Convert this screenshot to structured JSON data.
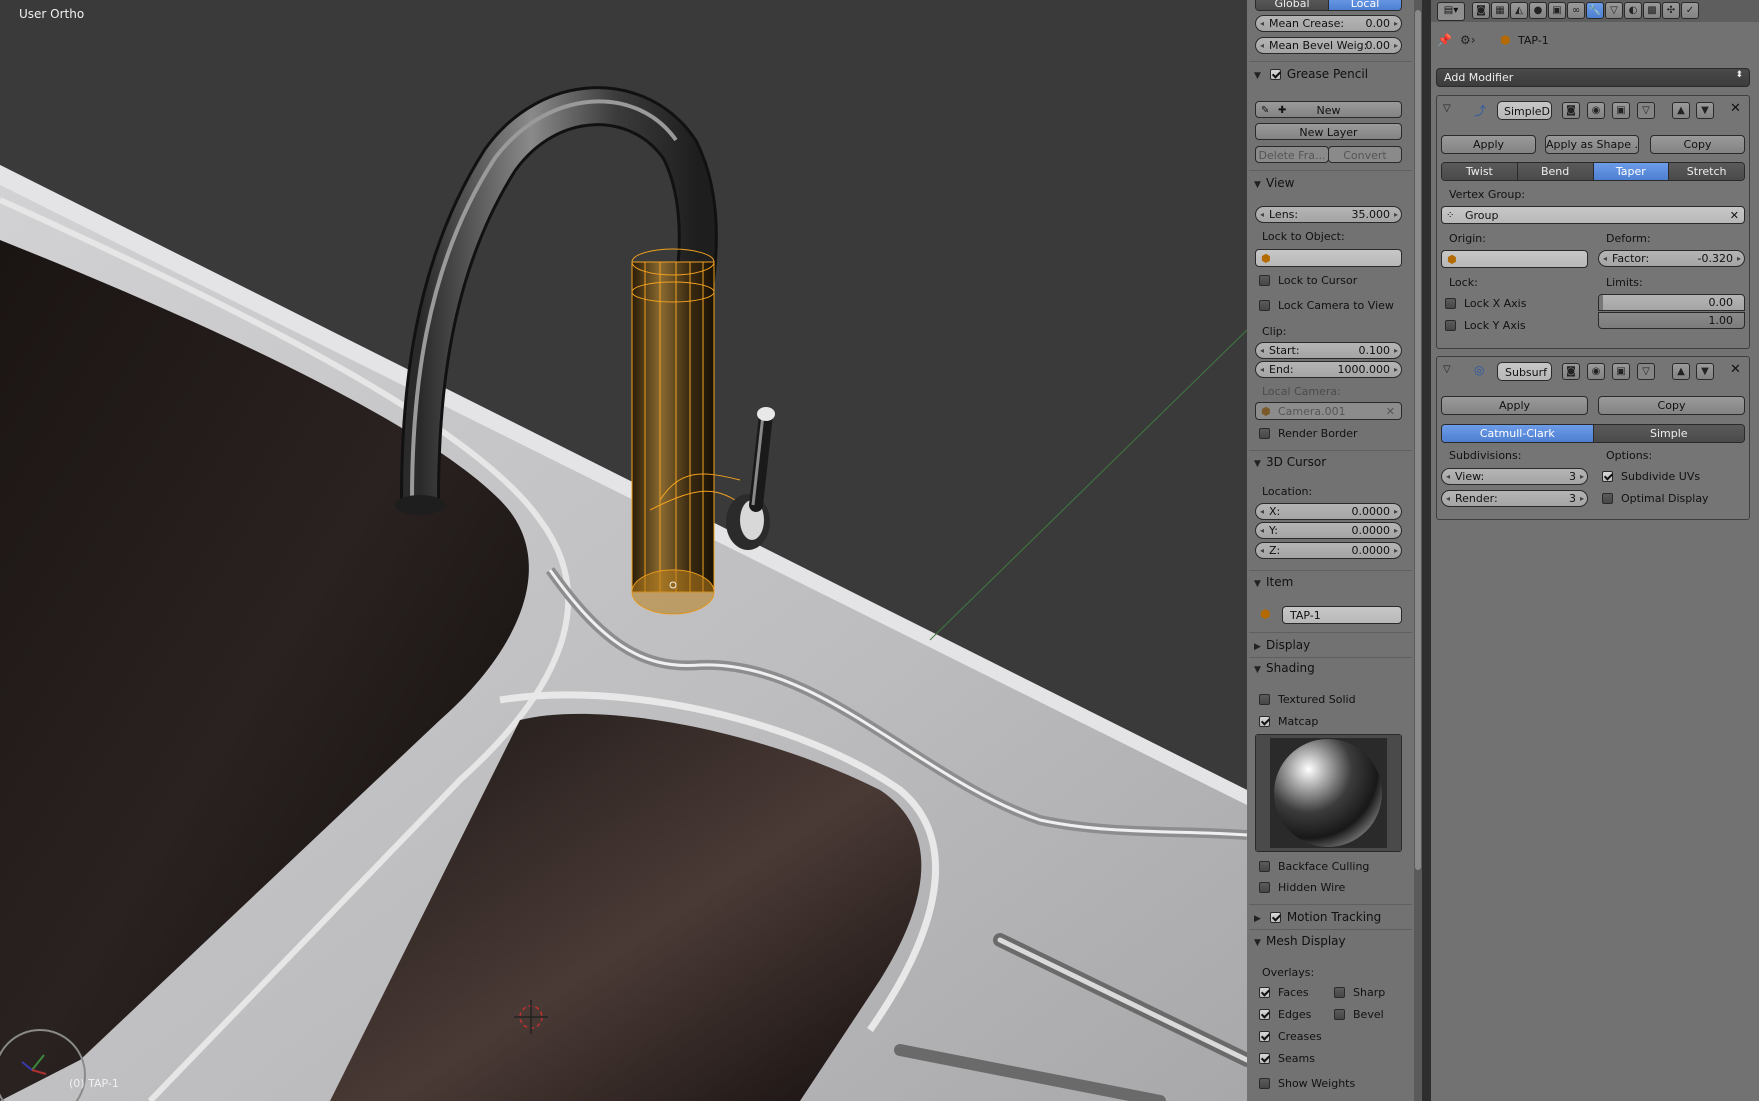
{
  "viewport": {
    "label": "User Ortho",
    "object_label": "(0) TAP-1"
  },
  "npanel": {
    "transform": {
      "global_btn": "Global",
      "local_btn": "Local",
      "mean_crease_label": "Mean Crease:",
      "mean_crease_value": "0.00",
      "mean_bevel_label": "Mean Bevel Weig:",
      "mean_bevel_value": "0.00"
    },
    "grease_pencil": {
      "title": "Grease Pencil",
      "enabled": true,
      "new_btn": "New",
      "new_layer_btn": "New Layer",
      "delete_frame_btn": "Delete Fra...",
      "convert_btn": "Convert"
    },
    "view": {
      "title": "View",
      "lens_label": "Lens:",
      "lens_value": "35.000",
      "lock_to_object_label": "Lock to Object:",
      "lock_to_cursor": "Lock to Cursor",
      "lock_camera_to_view": "Lock Camera to View",
      "clip_label": "Clip:",
      "clip_start_label": "Start:",
      "clip_start_value": "0.100",
      "clip_end_label": "End:",
      "clip_end_value": "1000.000",
      "local_camera_label": "Local Camera:",
      "local_camera_value": "Camera.001",
      "render_border": "Render Border"
    },
    "cursor": {
      "title": "3D Cursor",
      "location_label": "Location:",
      "x_label": "X:",
      "x_value": "0.0000",
      "y_label": "Y:",
      "y_value": "0.0000",
      "z_label": "Z:",
      "z_value": "0.0000"
    },
    "item": {
      "title": "Item",
      "name": "TAP-1"
    },
    "display": {
      "title": "Display"
    },
    "shading": {
      "title": "Shading",
      "textured_solid": "Textured Solid",
      "textured_solid_on": false,
      "matcap": "Matcap",
      "matcap_on": true,
      "backface_culling": "Backface Culling",
      "hidden_wire": "Hidden Wire"
    },
    "motion_tracking": {
      "title": "Motion Tracking",
      "enabled": true
    },
    "mesh_display": {
      "title": "Mesh Display",
      "overlays_label": "Overlays:",
      "faces": "Faces",
      "sharp": "Sharp",
      "edges": "Edges",
      "bevel": "Bevel",
      "creases": "Creases",
      "seams": "Seams",
      "show_weights": "Show Weights"
    }
  },
  "props": {
    "object_name": "TAP-1",
    "add_modifier": "Add Modifier",
    "simple_deform": {
      "name": "SimpleD",
      "apply_btn": "Apply",
      "apply_shape_btn": "Apply as Shape ...",
      "copy_btn": "Copy",
      "modes": [
        "Twist",
        "Bend",
        "Taper",
        "Stretch"
      ],
      "selected_mode": "Taper",
      "vertex_group_label": "Vertex Group:",
      "vertex_group_value": "Group",
      "origin_label": "Origin:",
      "deform_label": "Deform:",
      "factor_label": "Factor:",
      "factor_value": "-0.320",
      "lock_label": "Lock:",
      "limits_label": "Limits:",
      "lock_x": "Lock X Axis",
      "lock_y": "Lock Y Axis",
      "limit_low": "0.00",
      "limit_high": "1.00"
    },
    "subsurf": {
      "name": "Subsurf",
      "apply_btn": "Apply",
      "copy_btn": "Copy",
      "modes": [
        "Catmull-Clark",
        "Simple"
      ],
      "selected_mode": "Catmull-Clark",
      "subdivisions_label": "Subdivisions:",
      "options_label": "Options:",
      "view_label": "View:",
      "view_value": "3",
      "render_label": "Render:",
      "render_value": "3",
      "subdivide_uvs": "Subdivide UVs",
      "subdivide_uvs_on": true,
      "optimal_display": "Optimal Display",
      "optimal_display_on": false
    }
  },
  "colors": {
    "selection_orange": "#f0a020",
    "accent_blue": "#5a8de0",
    "viewport_bg": "#3a3a3a",
    "panel_bg": "#727272"
  }
}
